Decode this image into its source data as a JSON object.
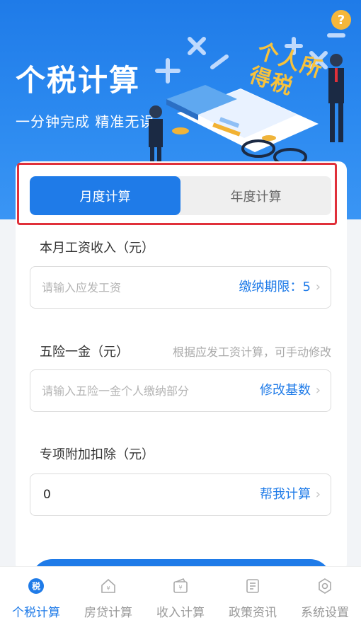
{
  "hero": {
    "title": "个税计算",
    "subtitle": "一分钟完成  精准无误",
    "help_label": "?",
    "illustration_text": "个人所得税"
  },
  "tabs": [
    {
      "label": "月度计算",
      "active": true
    },
    {
      "label": "年度计算",
      "active": false
    }
  ],
  "salary": {
    "label": "本月工资收入（元）",
    "placeholder": "请输入应发工资",
    "action": "缴纳期限：5"
  },
  "insurance": {
    "label": "五险一金（元）",
    "hint": "根据应发工资计算，可手动修改",
    "placeholder": "请输入五险一金个人缴纳部分",
    "action": "修改基数"
  },
  "deduction": {
    "label": "专项附加扣除（元）",
    "value": "0",
    "action": "帮我计算"
  },
  "tabbar": [
    {
      "label": "个税计算",
      "icon": "tax-icon",
      "active": true
    },
    {
      "label": "房贷计算",
      "icon": "house-icon",
      "active": false
    },
    {
      "label": "收入计算",
      "icon": "wallet-icon",
      "active": false
    },
    {
      "label": "政策资讯",
      "icon": "document-icon",
      "active": false
    },
    {
      "label": "系统设置",
      "icon": "gear-icon",
      "active": false
    }
  ],
  "colors": {
    "primary": "#1f7be8",
    "highlight_border": "#e0303a",
    "help": "#f5b73b"
  }
}
